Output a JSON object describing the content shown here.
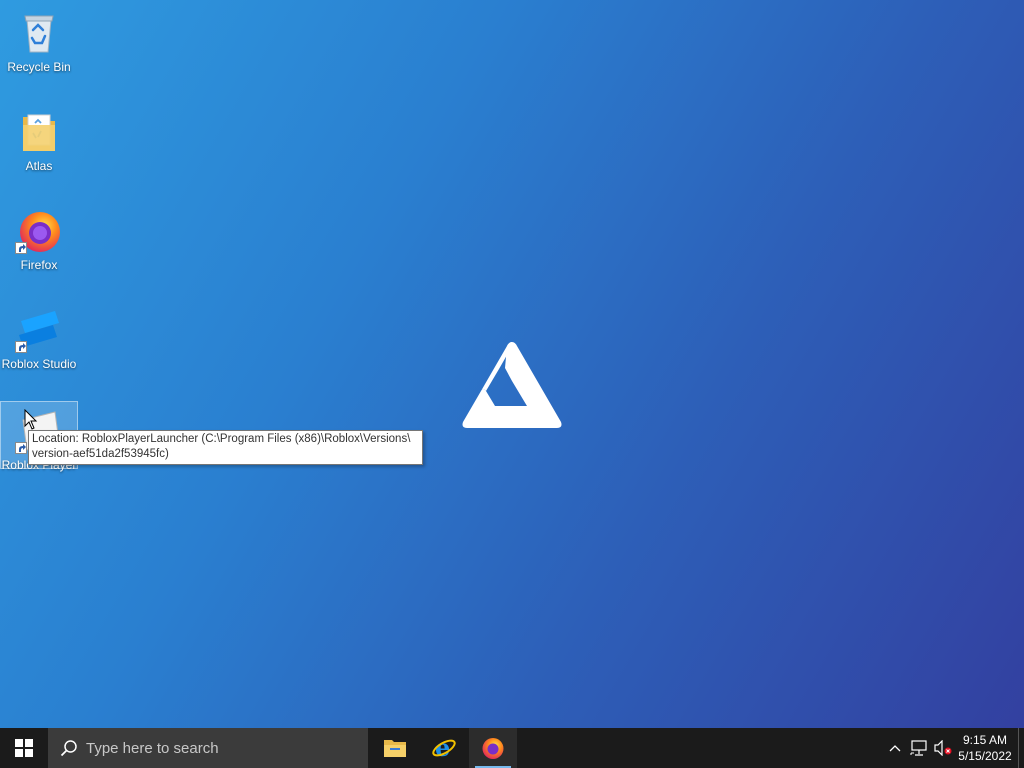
{
  "desktop": {
    "icons": [
      {
        "name": "recycle-bin",
        "label": "Recycle Bin",
        "shortcut": false,
        "icon": "recycle-bin-icon"
      },
      {
        "name": "atlas",
        "label": "Atlas",
        "shortcut": false,
        "icon": "folder-icon"
      },
      {
        "name": "firefox",
        "label": "Firefox",
        "shortcut": true,
        "icon": "firefox-icon"
      },
      {
        "name": "roblox-studio",
        "label": "Roblox Studio",
        "shortcut": true,
        "icon": "roblox-studio-icon"
      },
      {
        "name": "roblox-player",
        "label": "Roblox Player",
        "shortcut": true,
        "selected": true,
        "icon": "roblox-player-icon"
      }
    ],
    "tooltip": {
      "line1": "Location: RobloxPlayerLauncher (C:\\Program Files (x86)\\Roblox\\Versions\\",
      "line2": "version-aef51da2f53945fc)"
    },
    "center_logo": "atlas-logo-icon"
  },
  "taskbar": {
    "search_placeholder": "Type here to search",
    "pinned": [
      {
        "name": "file-explorer",
        "icon": "folder-icon"
      },
      {
        "name": "internet-explorer",
        "icon": "internet-explorer-icon"
      },
      {
        "name": "firefox",
        "icon": "firefox-icon",
        "running": true
      }
    ],
    "tray": [
      "chevron-up-icon",
      "network-icon",
      "volume-muted-icon"
    ],
    "clock": {
      "time": "9:15 AM",
      "date": "5/15/2022"
    }
  },
  "colors": {
    "desktop_gradient_start": "#2f9be0",
    "desktop_gradient_end": "#3340a0",
    "taskbar": "#1b1b1b",
    "search_box": "#3b3b3b",
    "running_indicator": "#76b9ed"
  }
}
